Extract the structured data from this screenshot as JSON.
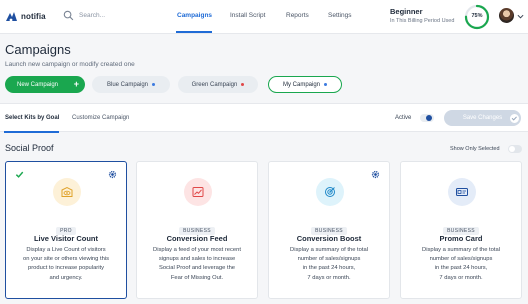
{
  "nav": {
    "brand": "notifia",
    "search_placeholder": "Search...",
    "links": [
      "Campaigns",
      "Install Script",
      "Reports",
      "Settings"
    ],
    "active_link": "Campaigns",
    "plan": {
      "name": "Beginner",
      "subtitle": "In This Billing Period Used",
      "usage_percent": 75,
      "usage_label": "75%"
    }
  },
  "header": {
    "title": "Campaigns",
    "subtitle": "Launch new campaign or modify created one"
  },
  "campaign_buttons": {
    "new": "New Campaign",
    "blue": "Blue Campaign",
    "green": "Green Campaign",
    "mine": "My Campaign"
  },
  "tabs": {
    "items": [
      "Select Kits by Goal",
      "Customize Campaign"
    ],
    "active": "Select Kits by Goal",
    "active_label": "Active",
    "save_label": "Save Changes"
  },
  "section": {
    "title": "Social Proof",
    "show_only_label": "Show Only Selected"
  },
  "cards": [
    {
      "badge": "PRO",
      "title": "Live Visitor Count",
      "lines": [
        "Display a Live Count of visitors",
        "on your site or others viewing this",
        "product to increase popularity",
        "and urgency."
      ],
      "selected": true
    },
    {
      "badge": "BUSINESS",
      "title": "Conversion Feed",
      "lines": [
        "Display a feed of your most recent",
        "signups and sales to increase",
        "Social Proof and leverage the",
        "Fear of Missing Out."
      ],
      "selected": false
    },
    {
      "badge": "BUSINESS",
      "title": "Conversion Boost",
      "lines": [
        "Display a summary of the total",
        "number of sales/signups",
        "in the past 24 hours,",
        "7 days or month."
      ],
      "selected": false
    },
    {
      "badge": "BUSINESS",
      "title": "Promo Card",
      "lines": [
        "Display a summary of the total",
        "number of sales/signups",
        "in the past 24 hours,",
        "7 days or month."
      ],
      "selected": false
    }
  ],
  "colors": {
    "accent_blue": "#1f6bd6",
    "green": "#1aa74f",
    "navy": "#1f4fa0",
    "blue_dot": "#3c7be0",
    "red_dot": "#e04848"
  },
  "icons": [
    "logo-icon",
    "search-icon",
    "chevron-down-icon",
    "checkmark-icon",
    "gear-icon",
    "eye-icon",
    "chart-icon",
    "target-icon",
    "card-icon"
  ]
}
